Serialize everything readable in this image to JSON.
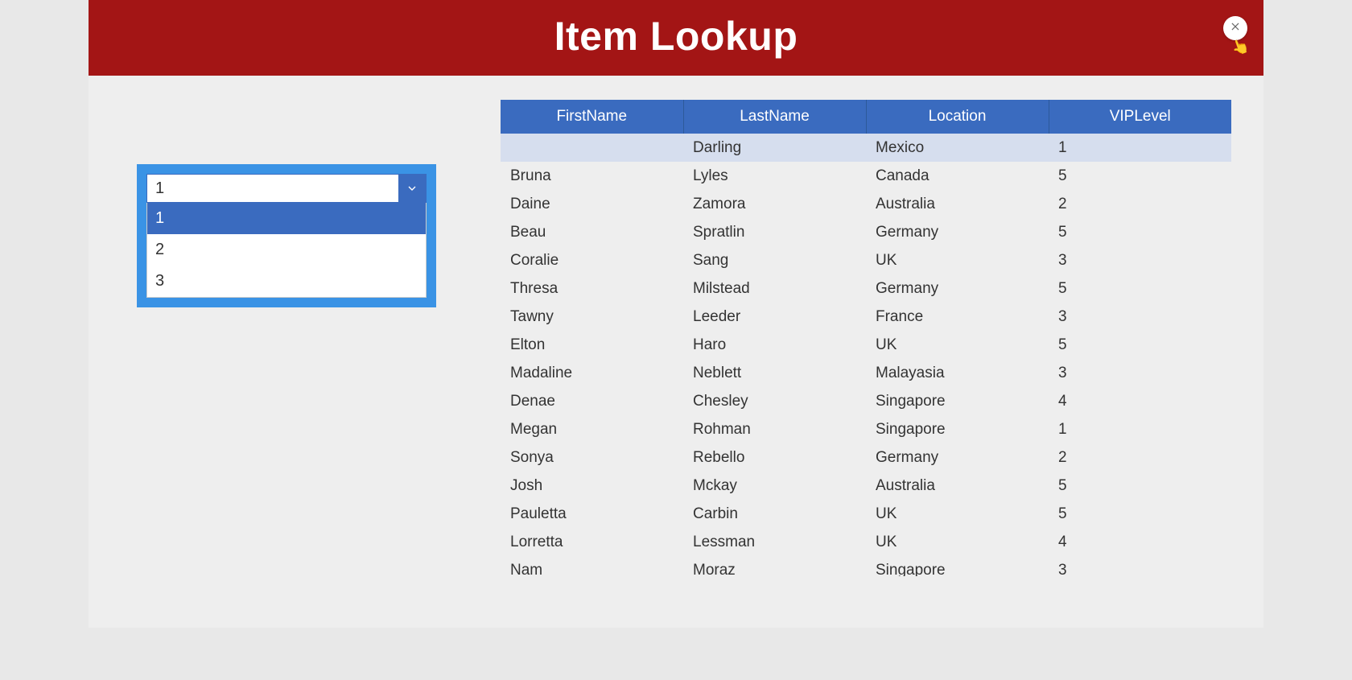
{
  "header": {
    "title": "Item Lookup"
  },
  "dropdown": {
    "selected": "1",
    "options": [
      "1",
      "2",
      "3"
    ]
  },
  "table": {
    "columns": [
      "FirstName",
      "LastName",
      "Location",
      "VIPLevel"
    ],
    "rows": [
      {
        "first": "",
        "last": "Darling",
        "loc": "Mexico",
        "vip": "1",
        "selected": true
      },
      {
        "first": "Bruna",
        "last": "Lyles",
        "loc": "Canada",
        "vip": "5",
        "selected": false
      },
      {
        "first": "Daine",
        "last": "Zamora",
        "loc": "Australia",
        "vip": "2",
        "selected": false
      },
      {
        "first": "Beau",
        "last": "Spratlin",
        "loc": "Germany",
        "vip": "5",
        "selected": false
      },
      {
        "first": "Coralie",
        "last": "Sang",
        "loc": "UK",
        "vip": "3",
        "selected": false
      },
      {
        "first": "Thresa",
        "last": "Milstead",
        "loc": "Germany",
        "vip": "5",
        "selected": false
      },
      {
        "first": "Tawny",
        "last": "Leeder",
        "loc": "France",
        "vip": "3",
        "selected": false
      },
      {
        "first": "Elton",
        "last": "Haro",
        "loc": "UK",
        "vip": "5",
        "selected": false
      },
      {
        "first": "Madaline",
        "last": "Neblett",
        "loc": "Malayasia",
        "vip": "3",
        "selected": false
      },
      {
        "first": "Denae",
        "last": "Chesley",
        "loc": "Singapore",
        "vip": "4",
        "selected": false
      },
      {
        "first": "Megan",
        "last": "Rohman",
        "loc": "Singapore",
        "vip": "1",
        "selected": false
      },
      {
        "first": "Sonya",
        "last": "Rebello",
        "loc": "Germany",
        "vip": "2",
        "selected": false
      },
      {
        "first": "Josh",
        "last": "Mckay",
        "loc": "Australia",
        "vip": "5",
        "selected": false
      },
      {
        "first": "Pauletta",
        "last": "Carbin",
        "loc": "UK",
        "vip": "5",
        "selected": false
      },
      {
        "first": "Lorretta",
        "last": "Lessman",
        "loc": "UK",
        "vip": "4",
        "selected": false
      },
      {
        "first": "Nam",
        "last": "Moraz",
        "loc": "Singapore",
        "vip": "3",
        "selected": false
      }
    ]
  }
}
